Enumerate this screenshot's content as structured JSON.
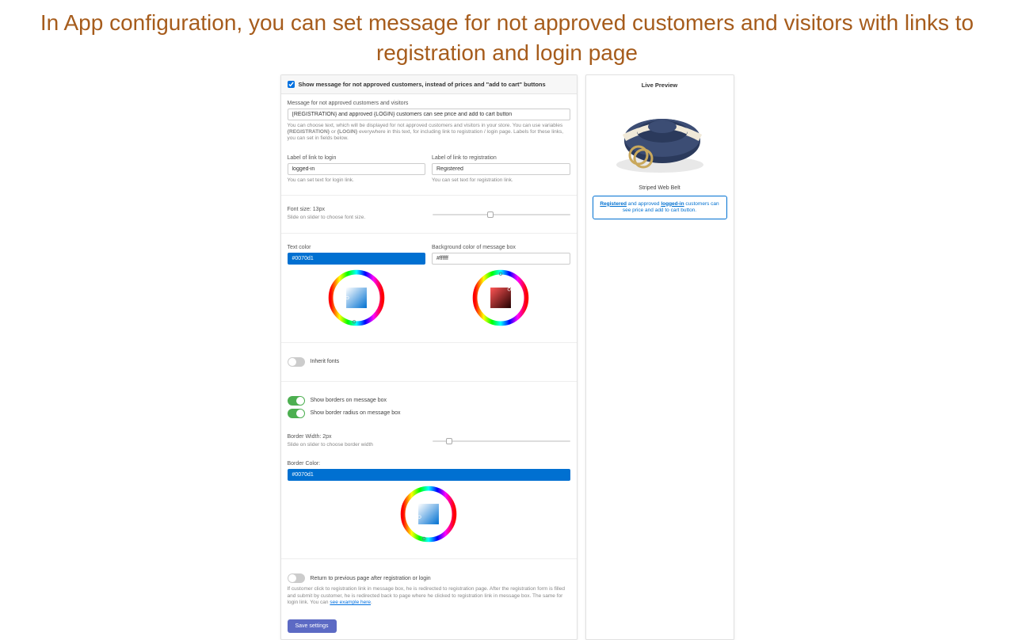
{
  "page_title": "In App configuration, you can set message for not approved customers and visitors with links to registration and login page",
  "header": {
    "checkbox_label": "Show message for not approved customers, instead of prices and \"add to cart\" buttons"
  },
  "message": {
    "label": "Message for not approved customers and visitors",
    "value": "{REGISTRATION} and approved {LOGIN} customers can see price and add to cart button",
    "helper_prefix": "You can choose text, which will be displayed for not approved customers and visitors in your store. You can use variables ",
    "helper_var1": "{REGISTRATION}",
    "helper_mid": " or ",
    "helper_var2": "{LOGIN}",
    "helper_suffix": " everywhere in this text, for including link to registration / login page. Labels for these links, you can set in fields below."
  },
  "login": {
    "label": "Label of link to login",
    "value": "logged-in",
    "helper": "You can set text for login link."
  },
  "registration": {
    "label": "Label of link to registration",
    "value": "Registered",
    "helper": "You can set text for registration link."
  },
  "fontsize": {
    "label": "Font size: 13px",
    "helper": "Slide on slider to choose font size."
  },
  "textcolor": {
    "label": "Text color",
    "value": "#0070d1"
  },
  "bgcolor": {
    "label": "Background color of message box",
    "value": "#ffffff"
  },
  "toggles": {
    "inherit_fonts": "Inherit fonts",
    "show_borders": "Show borders on message box",
    "show_radius": "Show border radius on message box"
  },
  "border": {
    "width_label": "Border Width: 2px",
    "width_helper": "Slide on slider to choose border width",
    "color_label": "Border Color:",
    "color_value": "#0070d1"
  },
  "return_toggle": "Return to previous page after registration or login",
  "footer_helper_prefix": "If customer click to registration link in message box, he is redirected to registration page. After the registration form is filled and submit by customer, he is redirected back to page where he clicked to registration link in message box. The same for login link. You can ",
  "footer_helper_link": "see example here",
  "save_label": "Save settings",
  "preview": {
    "title": "Live Preview",
    "product_name": "Striped Web Belt",
    "msg_reg": "Registered",
    "msg_mid": " and approved ",
    "msg_login": "logged-in",
    "msg_tail": " customers can see price and add to cart button."
  }
}
